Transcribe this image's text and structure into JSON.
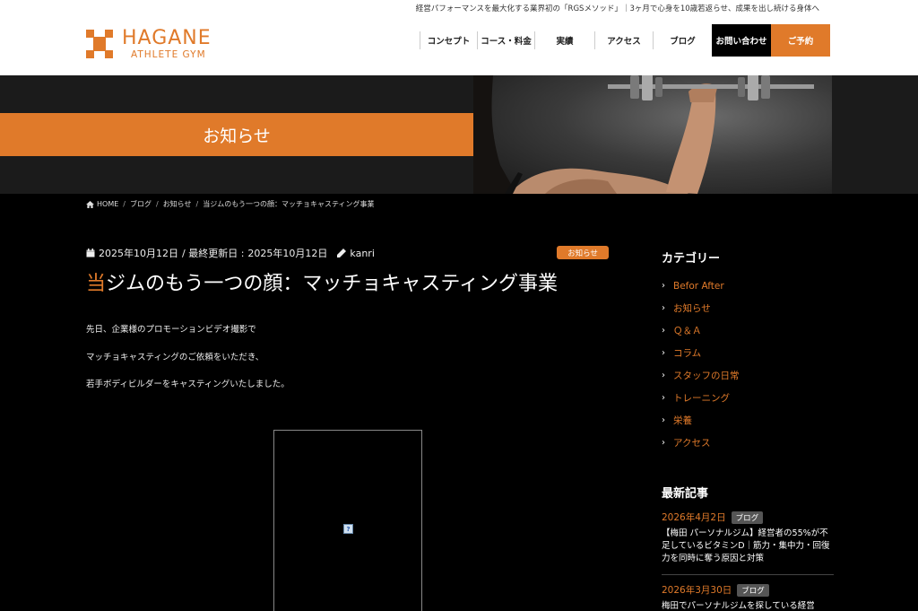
{
  "header": {
    "tagline": "経営パフォーマンスを最大化する業界初の「RGSメソッド」｜3ヶ月で心身を10歳若返らせ、成果を出し続ける身体へ",
    "logo_main": "HAGANE",
    "logo_sub": "ATHLETE GYM",
    "nav": [
      {
        "label": "コンセプト"
      },
      {
        "label": "コース・料金"
      },
      {
        "label": "実績"
      },
      {
        "label": "アクセス"
      },
      {
        "label": "ブログ"
      }
    ],
    "contact_label": "お問い合わせ",
    "reserve_label": "ご予約"
  },
  "banner": {
    "title": "お知らせ"
  },
  "breadcrumb": {
    "home": "HOME",
    "items": [
      "ブログ",
      "お知らせ",
      "当ジムのもう一つの顔：マッチョキャスティング事業"
    ]
  },
  "post": {
    "date": "2025年10月12日",
    "updated_label": "/ 最終更新日 :",
    "updated": "2025年10月12日",
    "author": "kanri",
    "category": "お知らせ",
    "title_first": "当",
    "title_rest": "ジムのもう一つの顔：マッチョキャスティング事業",
    "paragraphs": [
      "先日、企業様のプロモーションビデオ撮影で",
      "マッチョキャスティングのご依頼をいただき、",
      "若手ボディビルダーをキャスティングいたしました。"
    ],
    "video_placeholder": "?"
  },
  "sidebar": {
    "categories_heading": "カテゴリー",
    "categories": [
      "Befor After",
      "お知らせ",
      "Ｑ＆Ａ",
      "コラム",
      "スタッフの日常",
      "トレーニング",
      "栄養",
      "アクセス"
    ],
    "recent_heading": "最新記事",
    "recent": [
      {
        "date": "2026年4月2日",
        "tag": "ブログ",
        "title": "【梅田 パーソナルジム】経営者の55%が不足しているビタミンD｜筋力・集中力・回復力を同時に奪う原因と対策"
      },
      {
        "date": "2026年3月30日",
        "tag": "ブログ",
        "title": "梅田でパーソナルジムを探している経営"
      }
    ]
  },
  "colors": {
    "accent": "#e07a2a",
    "bg": "#000000",
    "header_bg": "#ffffff"
  }
}
